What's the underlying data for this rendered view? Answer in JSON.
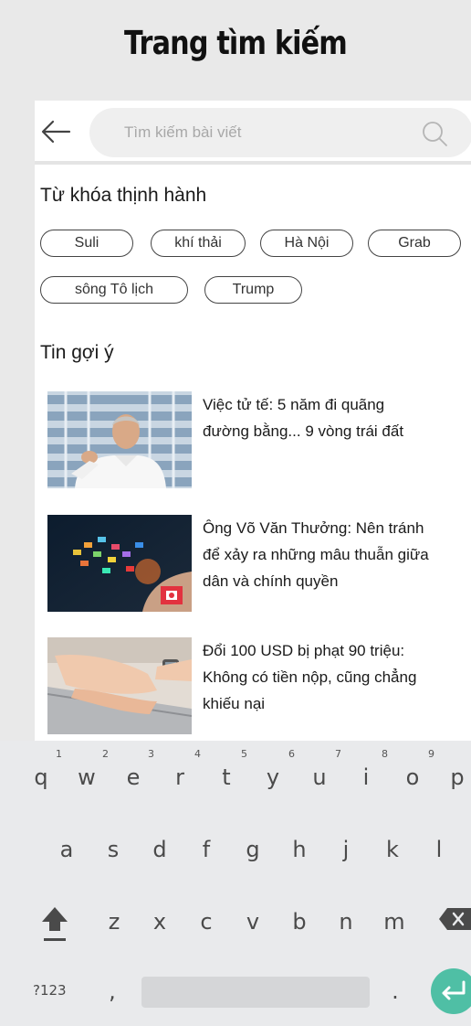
{
  "page_title": "Trang tìm kiếm",
  "search": {
    "placeholder": "Tìm kiếm bài viết"
  },
  "trending": {
    "title": "Từ khóa thịnh hành",
    "keywords": [
      "Suli",
      "khí thải",
      "Hà Nội",
      "Grab",
      "sông Tô lịch",
      "Trump"
    ]
  },
  "suggested": {
    "title": "Tin gợi ý",
    "items": [
      {
        "title_line1": "Việc tử tế: 5 năm đi quãng",
        "title_line2": "đường bằng... 9 vòng trái đất",
        "title_line3": ""
      },
      {
        "title_line1": "Ông Võ Văn Thưởng: Nên tránh",
        "title_line2": "để xảy ra những mâu thuẫn giữa",
        "title_line3": "dân và chính quyền"
      },
      {
        "title_line1": "Đổi 100 USD bị phạt 90 triệu:",
        "title_line2": "Không có tiền nộp, cũng chẳng",
        "title_line3": "khiếu nại"
      }
    ]
  },
  "keyboard": {
    "row1": [
      "q",
      "w",
      "e",
      "r",
      "t",
      "y",
      "u",
      "i",
      "o",
      "p"
    ],
    "row1_hints": [
      "1",
      "2",
      "3",
      "4",
      "5",
      "6",
      "7",
      "8",
      "9"
    ],
    "row2": [
      "a",
      "s",
      "d",
      "f",
      "g",
      "h",
      "j",
      "k",
      "l"
    ],
    "row3": [
      "z",
      "x",
      "c",
      "v",
      "b",
      "n",
      "m"
    ],
    "symbols_key": "?123",
    "comma_key": ",",
    "period_key": ".",
    "shift_icon": "shift-arrow-icon",
    "backspace_icon": "backspace-icon",
    "enter_icon": "enter-icon",
    "accent_color": "#4fbfa5"
  }
}
